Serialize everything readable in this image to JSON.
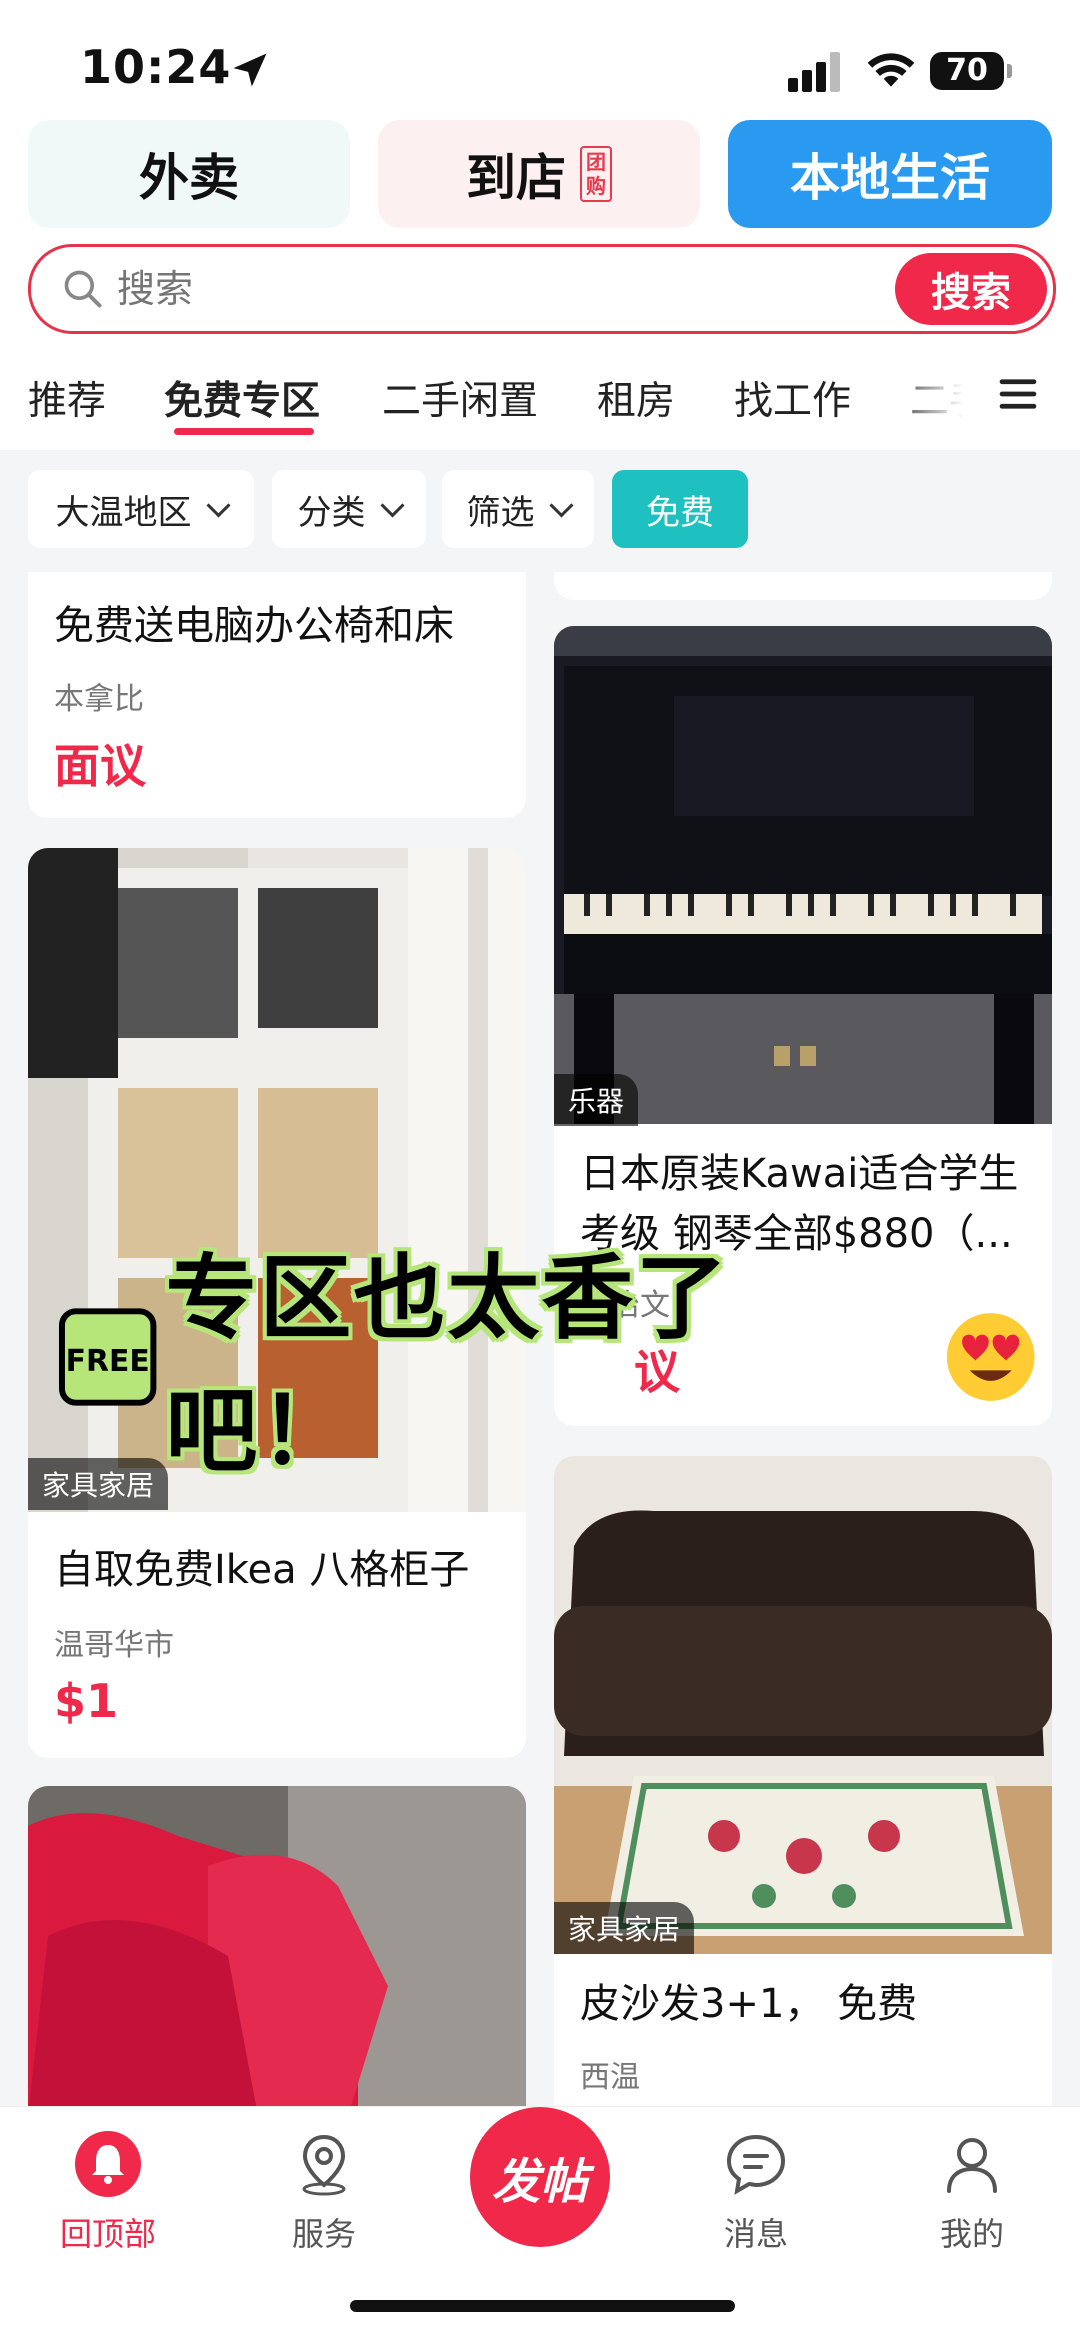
{
  "status_bar": {
    "time": "10:24",
    "battery": "70"
  },
  "top_tabs": [
    {
      "label": "外卖"
    },
    {
      "label": "到店",
      "badge": "团购"
    },
    {
      "label": "本地生活"
    }
  ],
  "search": {
    "placeholder": "搜索",
    "button": "搜索"
  },
  "categories": [
    "推荐",
    "免费专区",
    "二手闲置",
    "租房",
    "找工作",
    "二手"
  ],
  "active_category": "免费专区",
  "filters": [
    "大温地区",
    "分类",
    "筛选",
    "免费"
  ],
  "listings_left": [
    {
      "title": "免费送电脑办公椅和床",
      "location": "本拿比",
      "price": "面议"
    },
    {
      "tag": "家具家居",
      "title": "自取免费Ikea 八格柜子",
      "location": "温哥华市",
      "price": "$1"
    },
    {
      "tag": "",
      "title": ""
    }
  ],
  "listings_right": [
    {
      "tag": "乐器",
      "title_line1": "日本原装Kawai适合学生",
      "title_line2": "考级 钢琴全部$880（...",
      "location": "列治文",
      "price": "议"
    },
    {
      "tag": "家具家居",
      "title": "皮沙发3+1，  免费",
      "location": "西温"
    }
  ],
  "overlay_banner": {
    "text": "专区也太香了吧！",
    "badge": "FREE"
  },
  "bottom_nav": [
    {
      "label": "回顶部",
      "icon": "bell-icon",
      "active": true
    },
    {
      "label": "服务",
      "icon": "location-pin-icon"
    },
    {
      "label": "发帖",
      "icon": "post-icon"
    },
    {
      "label": "消息",
      "icon": "chat-icon"
    },
    {
      "label": "我的",
      "icon": "person-icon"
    }
  ],
  "colors": {
    "accent": "#f0284a",
    "blue": "#2a9af0",
    "teal": "#1fc1c0"
  }
}
